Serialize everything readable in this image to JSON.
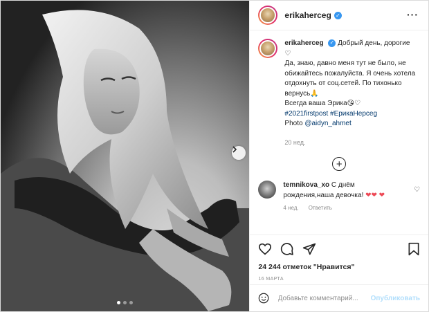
{
  "post": {
    "username": "erikaherceg",
    "caption_line1": "Добрый день, дорогие ♡",
    "caption_line2": "Да, знаю, давно меня тут не было, не обижайтесь пожалуйста. Я очень хотела отдохнуть от соц.сетей. По тихонько вернусь🙏",
    "caption_line3": "Всегда ваша Эрика😘♡",
    "caption_tags": "#2021firstpost #ЕрикаНерсеg",
    "caption_photo_label": "Photo",
    "caption_photo_mention": "@aidyn_ahmet",
    "age": "20 нед.",
    "likes": "24 244 отметок \"Нравится\"",
    "date": "16 марта"
  },
  "comment": {
    "username": "temnikova_xo",
    "text": "С днём рождения,наша девочка!",
    "hearts": "❤❤ ❤",
    "age": "4 нед.",
    "reply": "Ответить"
  },
  "composer": {
    "placeholder": "Добавьте комментарий...",
    "publish_label": "Опубликовать"
  },
  "icons": [
    "more-icon",
    "add-icon",
    "heart-icon",
    "comment-icon",
    "share-icon",
    "bookmark-icon",
    "emoji-icon",
    "next-arrow-icon"
  ],
  "carousel": {
    "slides": 3,
    "active": 1
  },
  "colors": {
    "accent": "#3897f0",
    "link": "#00376b",
    "muted": "#8e8e8e",
    "heart": "#ed4956"
  }
}
